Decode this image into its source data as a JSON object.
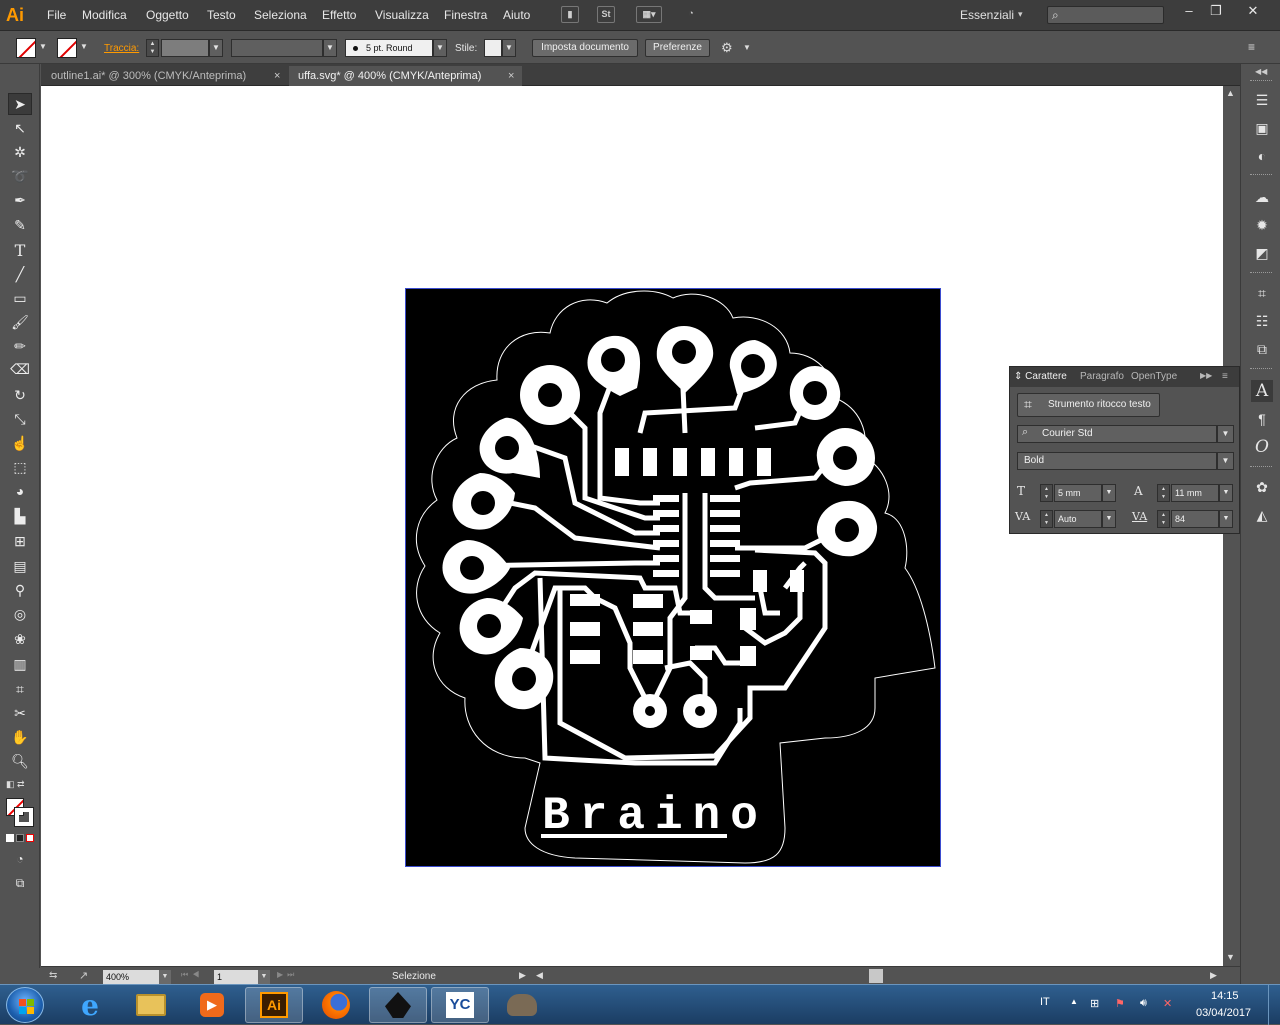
{
  "app": {
    "logo": "Ai",
    "menu": [
      "File",
      "Modifica",
      "Oggetto",
      "Testo",
      "Seleziona",
      "Effetto",
      "Visualizza",
      "Finestra",
      "Aiuto"
    ],
    "menubar_icons": [
      "bridge-icon",
      "stock-icon",
      "arrange-documents-icon",
      "gpu-performance-icon"
    ],
    "stock_label": "St",
    "workspace": "Essenziali",
    "search_placeholder": "",
    "accent_color": "#ff9a00"
  },
  "control_bar": {
    "stroke_label": "Traccia:",
    "brush_label": "5 pt. Round",
    "style_label": "Stile:",
    "document_setup_button": "Imposta documento",
    "preferences_button": "Preferenze"
  },
  "tabs": [
    {
      "label": "outline1.ai* @ 300% (CMYK/Anteprima)",
      "active": false
    },
    {
      "label": "uffa.svg* @ 400% (CMYK/Anteprima)",
      "active": true
    }
  ],
  "tools": [
    "selection-tool-icon",
    "direct-selection-tool-icon",
    "magic-wand-tool-icon",
    "lasso-tool-icon",
    "pen-tool-icon",
    "curvature-tool-icon",
    "type-tool-icon",
    "line-tool-icon",
    "rectangle-tool-icon",
    "paintbrush-tool-icon",
    "pencil-tool-icon",
    "eraser-tool-icon",
    "rotate-tool-icon",
    "scale-tool-icon",
    "warp-tool-icon",
    "free-transform-tool-icon",
    "shape-builder-tool-icon",
    "perspective-grid-tool-icon",
    "mesh-tool-icon",
    "gradient-tool-icon",
    "eyedropper-tool-icon",
    "blend-tool-icon",
    "symbol-sprayer-tool-icon",
    "column-graph-tool-icon",
    "artboard-tool-icon",
    "slice-tool-icon",
    "hand-tool-icon",
    "zoom-tool-icon"
  ],
  "artwork": {
    "text": "Braino",
    "background": "#000000",
    "foreground": "#ffffff"
  },
  "status_bar": {
    "zoom": "400%",
    "artboard": "1",
    "status": "Selezione"
  },
  "character_panel": {
    "tabs": [
      "Carattere",
      "Paragrafo",
      "OpenType"
    ],
    "touch_type_button": "Strumento ritocco testo",
    "font_family": "Courier Std",
    "font_style": "Bold",
    "font_size": "5 mm",
    "leading": "11 mm",
    "kerning": "Auto",
    "tracking": "84"
  },
  "right_dock_icons": [
    "color-panel-icon",
    "gradient-panel-icon",
    "swatches-panel-icon",
    "brushes-panel-icon",
    "symbols-panel-icon",
    "graphic-styles-panel-icon",
    "transform-panel-icon",
    "align-panel-icon",
    "pathfinder-panel-icon",
    "character-panel-icon",
    "paragraph-panel-icon",
    "opentype-panel-icon",
    "appearance-panel-icon",
    "layers-panel-icon"
  ],
  "taskbar": {
    "language": "IT",
    "time": "14:15",
    "date": "03/04/2017",
    "apps": [
      "internet-explorer",
      "file-explorer",
      "media-player",
      "illustrator",
      "firefox",
      "inkscape",
      "yc-app",
      "gimp"
    ]
  }
}
